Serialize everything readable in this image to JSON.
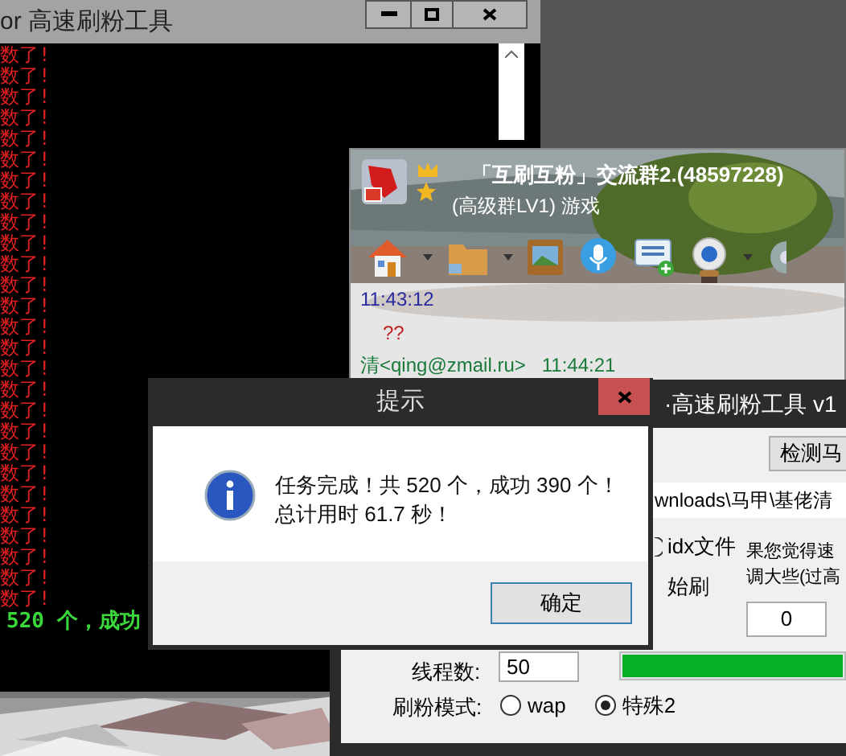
{
  "console_window": {
    "title": "or 高速刷粉工具",
    "lines": [
      "数了!",
      "数了!",
      "数了!",
      "数了!",
      "数了!",
      "数了!",
      "数了!",
      "数了!",
      "数了!",
      "数了!",
      "数了!",
      "数了!",
      "数了!",
      "数了!",
      "数了!",
      "数了!",
      "数了!",
      "数了!",
      "数了!",
      "数了!",
      "数了!",
      "数了!",
      "数了!",
      "数了!",
      "数了!",
      "数了!",
      "数了!"
    ],
    "summary": "520 个，成功"
  },
  "chat_window": {
    "group_name": "「互刷互粉」交流群2.(48597228)",
    "group_info": "(高级群LV1) 游戏",
    "messages": [
      {
        "kind": "time",
        "text": "11:43:12"
      },
      {
        "kind": "body",
        "text": "??"
      },
      {
        "kind": "sender",
        "text": "清<qing@zmail.ru>",
        "time": "11:44:21"
      }
    ]
  },
  "tool_window": {
    "title": "·高速刷粉工具 v1",
    "check_button": "检测马",
    "path": "wnloads\\马甲\\基佬清",
    "file_option": "idx文件",
    "hint_lines": [
      "果您觉得速",
      "调大些(过高"
    ],
    "start_label": "始刷",
    "count": {
      "value": "0"
    },
    "progress": {
      "level": 1
    },
    "threads": {
      "label": "线程数:",
      "value": "50"
    },
    "mode": {
      "label": "刷粉模式:",
      "options": [
        {
          "label": "wap",
          "selected": false
        },
        {
          "label": "特殊2",
          "selected": true
        }
      ]
    }
  },
  "dialog": {
    "title": "提示",
    "message_lines": [
      "任务完成！共 520 个，成功 390 个！",
      "总计用时 61.7 秒！"
    ],
    "ok_button": "确定"
  }
}
